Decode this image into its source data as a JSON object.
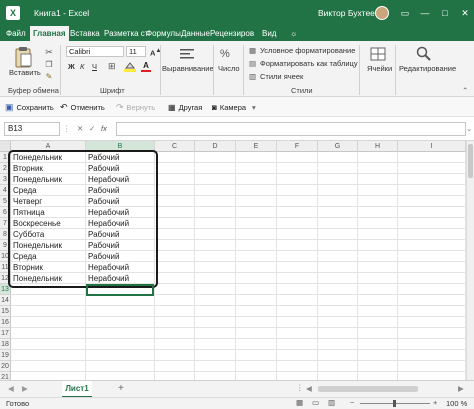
{
  "titlebar": {
    "title": "Книга1 - Excel",
    "user": "Виктор Бухтеев",
    "app_icon": "X"
  },
  "tabs": [
    "Файл",
    "Главная",
    "Вставка",
    "Разметка ст",
    "Формулы",
    "Данные",
    "Рецензиров",
    "Вид"
  ],
  "tell_me_icon": "lightbulb-icon",
  "ribbon": {
    "paste": "Вставить",
    "clipboard": "Буфер обмена",
    "font_name": "Calibri",
    "font_size": "11",
    "bold": "Ж",
    "italic": "К",
    "underline": "Ч",
    "font_group": "Шрифт",
    "alignment": "Выравнивание",
    "number": "Число",
    "cond_format": "Условное форматирование",
    "format_table": "Форматировать как таблицу",
    "cell_styles": "Стили ячеек",
    "styles_group": "Стили",
    "cells": "Ячейки",
    "editing": "Редактирование"
  },
  "qat": {
    "save": "Сохранить",
    "undo": "Отменить",
    "redo": "Вернуть",
    "other": "Другая",
    "camera": "Камера"
  },
  "formula_bar": {
    "name_box": "B13",
    "cancel": "✕",
    "enter": "✓",
    "fx": "fx",
    "value": ""
  },
  "columns": [
    "A",
    "B",
    "C",
    "D",
    "E",
    "F",
    "G",
    "H",
    "I"
  ],
  "rows": [
    "1",
    "2",
    "3",
    "4",
    "5",
    "6",
    "7",
    "8",
    "9",
    "10",
    "11",
    "12",
    "13",
    "14",
    "15",
    "16",
    "17",
    "18",
    "19",
    "20",
    "21"
  ],
  "cells": [
    [
      "Понедельник",
      "Рабочий"
    ],
    [
      "Вторник",
      "Рабочий"
    ],
    [
      "Понедельник",
      "Нерабочий"
    ],
    [
      "Среда",
      "Рабочий"
    ],
    [
      "Четверг",
      "Рабочий"
    ],
    [
      "Пятница",
      "Нерабочий"
    ],
    [
      "Воскресенье",
      "Нерабочий"
    ],
    [
      "Суббота",
      "Рабочий"
    ],
    [
      "Понедельник",
      "Рабочий"
    ],
    [
      "Среда",
      "Рабочий"
    ],
    [
      "Вторник",
      "Нерабочий"
    ],
    [
      "Понедельник",
      "Нерабочий"
    ]
  ],
  "sheet": {
    "tab": "Лист1",
    "add": "+"
  },
  "status": {
    "ready": "Готово",
    "zoom": "100 %"
  },
  "colors": {
    "accent": "#217346",
    "selected_header": "#d3e6d9"
  }
}
